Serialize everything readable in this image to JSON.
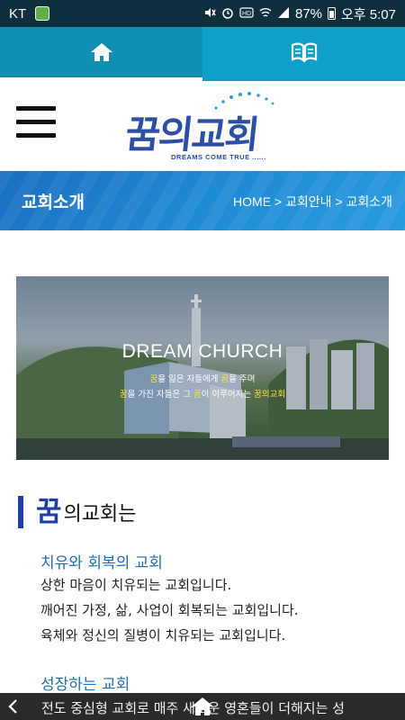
{
  "status_bar": {
    "carrier": "KT",
    "battery": "87%",
    "time": "오후 5:07",
    "icons": [
      "mute-icon",
      "alarm-icon",
      "hd-icon",
      "wifi-icon",
      "signal-icon",
      "battery-icon"
    ]
  },
  "tabs": [
    {
      "icon": "home-icon",
      "active": true
    },
    {
      "icon": "book-icon",
      "active": false
    }
  ],
  "header": {
    "logo_text": "꿈의교회",
    "logo_tagline": "DREAMS COME TRUE ......"
  },
  "title_bar": {
    "title": "교회소개",
    "breadcrumb": "HOME > 교회안내 > 교회소개"
  },
  "hero": {
    "title": "DREAM CHURCH",
    "line1_a": "꿈",
    "line1_b": "을 잃은 자들에게 ",
    "line1_c": "꿈",
    "line1_d": "을 주며",
    "line2_a": "꿈",
    "line2_b": "을 가진 자들은 그 ",
    "line2_c": "꿈",
    "line2_d": "이 이루어지는 ",
    "line2_e": "꿈의교회"
  },
  "section": {
    "big": "꿈",
    "rest": "의교회는"
  },
  "blocks": [
    {
      "title": "치유와 회복의 교회",
      "lines": [
        "상한 마음이 치유되는 교회입니다.",
        "깨어진 가정, 삶, 사업이 회복되는 교회입니다.",
        "육체와 정신의 질병이 치유되는 교회입니다."
      ]
    },
    {
      "title": "성장하는 교회",
      "lines": []
    }
  ],
  "bottom_bar": {
    "ticker": "전도 중심형 교회로 매주 새로운 영혼들이 더해지는 성"
  },
  "colors": {
    "status_bar": "#0d2f3e",
    "tab_bar": "#0ea0c8",
    "accent_blue": "#1d3fa8",
    "subtitle_blue": "#1d6fc0",
    "highlight_yellow": "#ffe23a"
  }
}
